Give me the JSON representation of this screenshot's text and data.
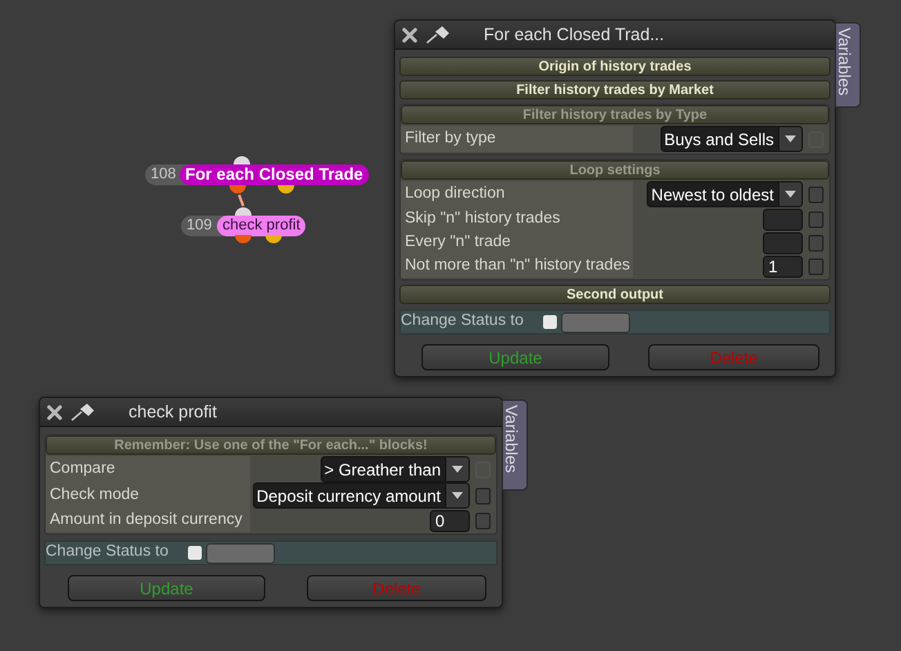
{
  "nodes": [
    {
      "number": "108",
      "label": "For each Closed Trade",
      "color": "#c000c0"
    },
    {
      "number": "109",
      "label": "check profit",
      "color": "#f07ef0"
    }
  ],
  "windows": [
    {
      "title": "For each Closed Trad...",
      "side_tab": "Variables",
      "sections": [
        {
          "title": "Origin of history trades",
          "expanded": false
        },
        {
          "title": "Filter history trades by Market",
          "expanded": false
        },
        {
          "title": "Filter history trades by Type",
          "expanded": true,
          "rows": [
            {
              "kind": "select",
              "label": "Filter by type",
              "value": "Buys and Sells",
              "checked": false,
              "disabled": true
            }
          ]
        },
        {
          "title": "Loop settings",
          "expanded": true,
          "rows": [
            {
              "kind": "select",
              "label": "Loop direction",
              "value": "Newest to oldest",
              "checked": false,
              "disabled": false
            },
            {
              "kind": "number",
              "label": "Skip \"n\" history trades",
              "checked": false,
              "disabled": false
            },
            {
              "kind": "number",
              "label": "Every \"n\" trade",
              "checked": false,
              "disabled": false
            },
            {
              "kind": "number",
              "label": "Not more than \"n\" history trades",
              "value": "1",
              "checked": false,
              "disabled": false
            }
          ]
        },
        {
          "title": "Second output",
          "expanded": false
        }
      ],
      "status": {
        "label": "Change Status to",
        "checked": false
      },
      "buttons": [
        {
          "kind": "update",
          "label": "Update"
        },
        {
          "kind": "delete",
          "label": "Delete"
        }
      ]
    },
    {
      "title": "check profit",
      "side_tab": "Variables",
      "sections": [
        {
          "title": "Remember: Use one of the \"For each...\" blocks!",
          "expanded": true,
          "rows": [
            {
              "kind": "select",
              "label": "Compare",
              "value": "> Greather than",
              "checked": false,
              "disabled": true
            },
            {
              "kind": "select",
              "label": "Check mode",
              "value": "Deposit currency amount",
              "checked": false,
              "disabled": false
            },
            {
              "kind": "number",
              "label": "Amount in deposit currency",
              "value": "0",
              "checked": false,
              "disabled": false
            }
          ]
        }
      ],
      "status": {
        "label": "Change Status to",
        "checked": false
      },
      "buttons": [
        {
          "kind": "update",
          "label": "Update"
        },
        {
          "kind": "delete",
          "label": "Delete"
        }
      ]
    }
  ]
}
